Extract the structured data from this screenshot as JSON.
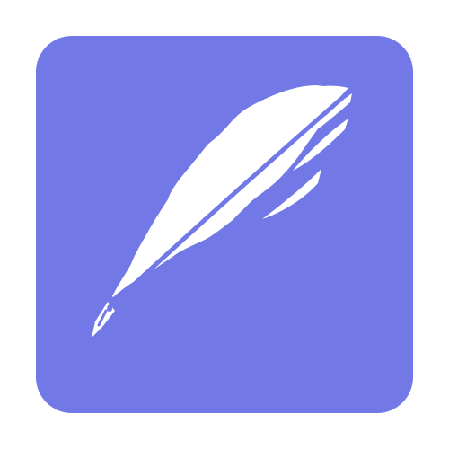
{
  "icon": {
    "name": "feather-quill-icon",
    "background_color": "#7279E7",
    "glyph_color": "#FFFFFF"
  }
}
